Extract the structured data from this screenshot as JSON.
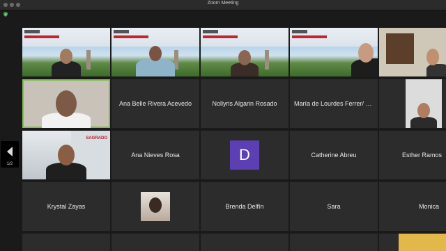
{
  "window": {
    "title": "Zoom Meeting"
  },
  "pager": {
    "page": "1/2"
  },
  "participants_named": [
    "Ana Belle Rivera Acevedo",
    "Nollyris Algarin Rosado",
    "María de Lourdes Ferrer/ Un...",
    "Ana Nieves Rosa",
    "Catherine Abreu",
    "Esther Ramos",
    "Krystal Zayas",
    "Brenda Delfín",
    "Sara",
    "Monica"
  ],
  "avatar_letter": "D",
  "banner_text": "SAGRADO"
}
